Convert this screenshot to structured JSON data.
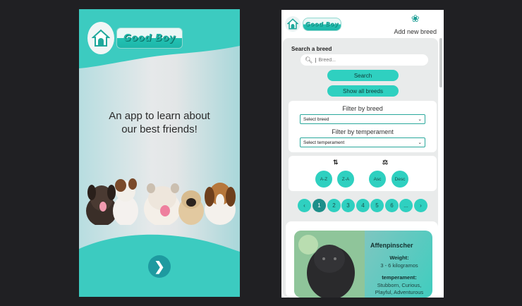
{
  "landing": {
    "brand": "Good Boy",
    "tagline_line1": "An app to learn about",
    "tagline_line2": "our best friends!",
    "next_icon": "chevron-right-icon"
  },
  "app": {
    "brand": "Good Boy",
    "add_breed_label": "Add new breed",
    "search": {
      "title": "Search a breed",
      "placeholder": "Breed...",
      "search_button": "Search",
      "show_all_button": "Show all breeds"
    },
    "filters": {
      "by_breed_label": "Filter by breed",
      "breed_select_value": "Select breed",
      "by_temperament_label": "Filter by temperament",
      "temperament_select_value": "Select temperament"
    },
    "sort": {
      "alpha_icon": "sort-alpha-icon",
      "weight_icon": "weight-icon",
      "az": "A-Z",
      "za": "Z-A",
      "asc": "Asc",
      "desc": "Desc"
    },
    "pagination": {
      "prev": "‹",
      "pages": [
        "1",
        "2",
        "3",
        "4",
        "5",
        "6",
        "..."
      ],
      "next": "›",
      "current": "1"
    },
    "dog_card": {
      "name": "Affenpinscher",
      "weight_label": "Weight:",
      "weight_value": "3 - 6 kilogramos",
      "temperament_label": "temperament:",
      "temperament_value_line1": "Stubborn, Curious,",
      "temperament_value_line2": "Playful, Adventurous"
    }
  },
  "colors": {
    "teal": "#2fd0c0",
    "teal_dark": "#1d8f8a",
    "background": "#202023"
  }
}
